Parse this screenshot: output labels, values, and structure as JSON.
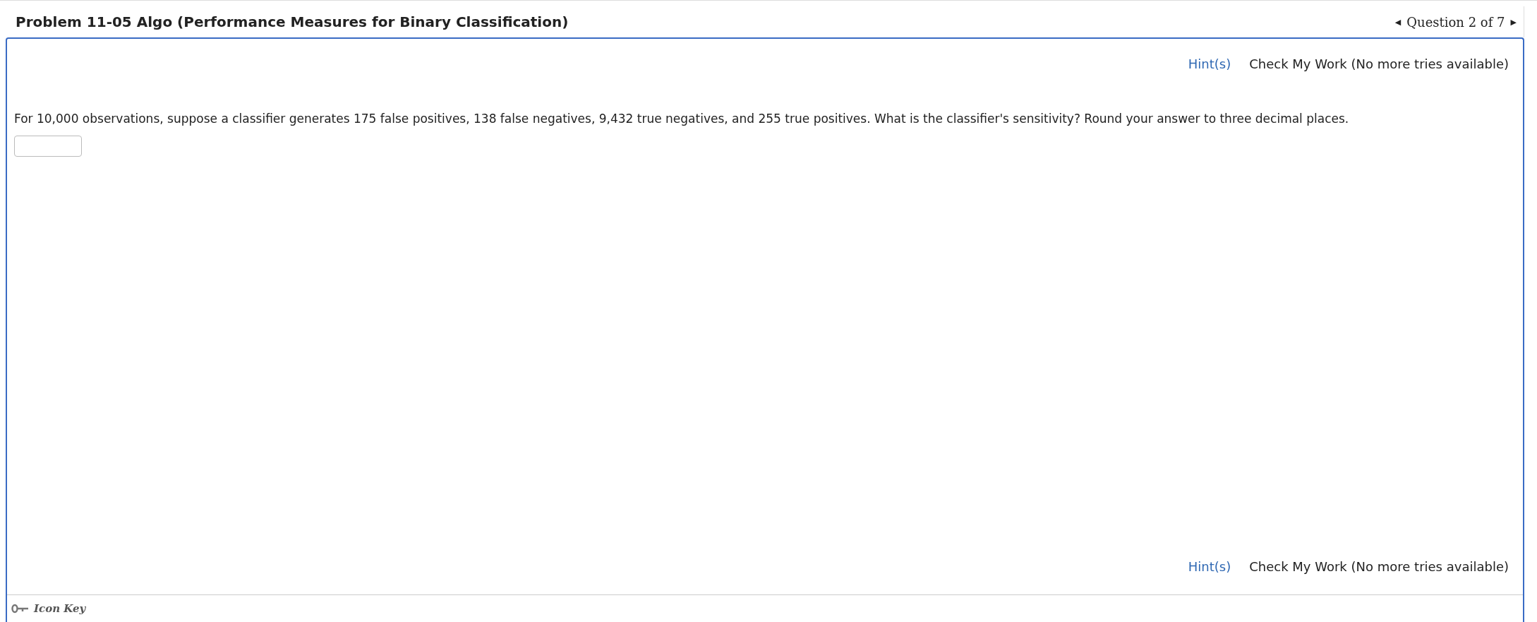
{
  "header": {
    "title": "Problem 11-05 Algo (Performance Measures for Binary Classification)",
    "pager": {
      "prev": "◀",
      "label": "Question 2 of 7",
      "next": "▶"
    }
  },
  "top_actions": {
    "hint": "Hint(s)",
    "check": "Check My Work (No more tries available)"
  },
  "question": {
    "text": "For 10,000 observations, suppose a classifier generates 175 false positives, 138 false negatives, 9,432 true negatives, and 255 true positives. What is the classifier's sensitivity? Round your answer to three decimal places."
  },
  "bottom_actions": {
    "hint": "Hint(s)",
    "check": "Check My Work (No more tries available)"
  },
  "footer": {
    "icon_key": "Icon Key"
  }
}
